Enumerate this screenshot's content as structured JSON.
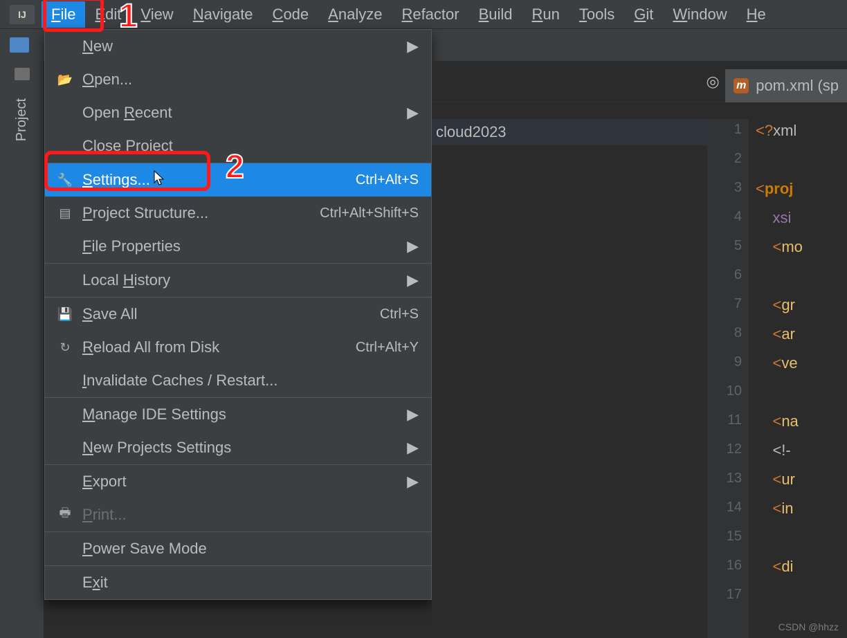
{
  "menubar": {
    "logo": "IJ",
    "items": [
      "File",
      "Edit",
      "View",
      "Navigate",
      "Code",
      "Analyze",
      "Refactor",
      "Build",
      "Run",
      "Tools",
      "Git",
      "Window",
      "He"
    ],
    "active_index": 0
  },
  "project_side_label": "Project",
  "dropdown": {
    "items": [
      {
        "label": "New",
        "arrow": true
      },
      {
        "label": "Open...",
        "icon": "folder-open-icon"
      },
      {
        "label": "Open Recent",
        "arrow": true
      },
      {
        "label": "Close Project"
      },
      "sep",
      {
        "label": "Settings...",
        "icon": "wrench-icon",
        "shortcut": "Ctrl+Alt+S",
        "highlight": true
      },
      {
        "label": "Project Structure...",
        "icon": "project-structure-icon",
        "shortcut": "Ctrl+Alt+Shift+S"
      },
      {
        "label": "File Properties",
        "arrow": true
      },
      "sep",
      {
        "label": "Local History",
        "arrow": true
      },
      "sep",
      {
        "label": "Save All",
        "icon": "save-icon",
        "shortcut": "Ctrl+S"
      },
      {
        "label": "Reload All from Disk",
        "icon": "reload-icon",
        "shortcut": "Ctrl+Alt+Y"
      },
      {
        "label": "Invalidate Caches / Restart..."
      },
      "sep",
      {
        "label": "Manage IDE Settings",
        "arrow": true
      },
      {
        "label": "New Projects Settings",
        "arrow": true
      },
      "sep",
      {
        "label": "Export",
        "arrow": true
      },
      {
        "label": "Print...",
        "icon": "print-icon",
        "disabled": true
      },
      "sep",
      {
        "label": "Power Save Mode"
      },
      "sep",
      {
        "label": "Exit"
      }
    ]
  },
  "editor": {
    "toolbar_icons": [
      "target-icon",
      "expand-icon",
      "collapse-icon",
      "divider",
      "gear-icon",
      "minimize-icon"
    ],
    "active_tab": "pom.xml (sp",
    "tree_row": "cloud2023",
    "lines": [
      {
        "n": "1",
        "html": "<span class='punct'>&lt;?</span><span class='pi'>xml</span>"
      },
      {
        "n": "2",
        "html": ""
      },
      {
        "n": "3",
        "html": "<span class='punct'>&lt;</span><span class='proj-tag'>proj</span>"
      },
      {
        "n": "4",
        "html": "    <span class='attr'>xsi</span>"
      },
      {
        "n": "5",
        "html": "    <span class='punct'>&lt;</span><span class='tag'>mo</span>"
      },
      {
        "n": "6",
        "html": ""
      },
      {
        "n": "7",
        "html": "    <span class='punct'>&lt;</span><span class='tag'>gr</span>"
      },
      {
        "n": "8",
        "html": "    <span class='punct'>&lt;</span><span class='tag'>ar</span>"
      },
      {
        "n": "9",
        "html": "    <span class='punct'>&lt;</span><span class='tag'>ve</span>"
      },
      {
        "n": "10",
        "html": ""
      },
      {
        "n": "11",
        "html": "    <span class='punct'>&lt;</span><span class='tag'>na</span>"
      },
      {
        "n": "12",
        "html": "    <span class='pi'>&lt;!-</span>"
      },
      {
        "n": "13",
        "html": "    <span class='punct'>&lt;</span><span class='tag'>ur</span>"
      },
      {
        "n": "14",
        "html": "    <span class='punct'>&lt;</span><span class='tag'>in</span>"
      },
      {
        "n": "15",
        "html": ""
      },
      {
        "n": "16",
        "html": "    <span class='punct'>&lt;</span><span class='tag'>di</span>"
      },
      {
        "n": "17",
        "html": ""
      }
    ]
  },
  "callouts": {
    "c1": "1",
    "c2": "2"
  },
  "watermark": "CSDN @hhzz"
}
